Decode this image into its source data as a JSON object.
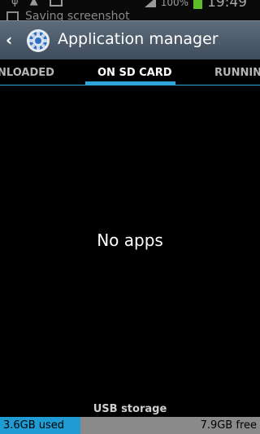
{
  "status_bar": {
    "battery_percent": "100%",
    "time": "19:49",
    "ticker": "Saving screenshot",
    "icons": [
      "usb-icon",
      "android-debug-icon",
      "image-icon",
      "signal-icon",
      "battery-icon"
    ]
  },
  "action_bar": {
    "title": "Application manager",
    "back_icon": "chevron-left-icon",
    "app_icon": "settings-gear-icon"
  },
  "tabs": [
    {
      "label": "DOWNLOADED",
      "visible_text": "NLOADED",
      "selected": false
    },
    {
      "label": "ON SD CARD",
      "visible_text": "ON SD CARD",
      "selected": true
    },
    {
      "label": "RUNNING",
      "visible_text": "RUNNING",
      "selected": false
    }
  ],
  "content": {
    "empty_message": "No apps"
  },
  "storage": {
    "label": "USB storage",
    "used": "3.6GB used",
    "free": "7.9GB free",
    "used_fraction": 0.31,
    "used_color": "#1e9cd3",
    "free_color": "#8a8a8a"
  },
  "colors": {
    "accent": "#2fa4d8",
    "action_bar": "#4d5b6a",
    "battery": "#5cc02a"
  }
}
